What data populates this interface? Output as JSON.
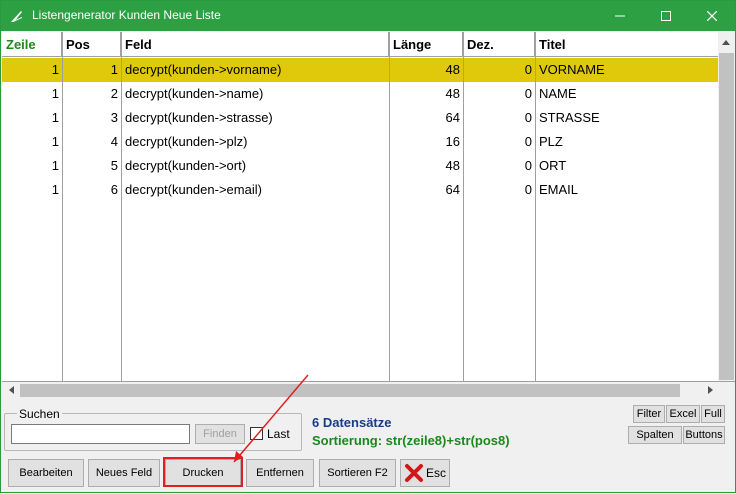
{
  "window": {
    "title": "Listengenerator Kunden Neue Liste"
  },
  "grid": {
    "columns": [
      "Zeile",
      "Pos",
      "Feld",
      "Länge",
      "Dez.",
      "Titel"
    ],
    "rows": [
      {
        "zeile": "1",
        "pos": "1",
        "feld": "decrypt(kunden->vorname)",
        "laenge": "48",
        "dez": "0",
        "titel": "VORNAME",
        "selected": true
      },
      {
        "zeile": "1",
        "pos": "2",
        "feld": "decrypt(kunden->name)",
        "laenge": "48",
        "dez": "0",
        "titel": "NAME"
      },
      {
        "zeile": "1",
        "pos": "3",
        "feld": "decrypt(kunden->strasse)",
        "laenge": "64",
        "dez": "0",
        "titel": "STRASSE"
      },
      {
        "zeile": "1",
        "pos": "4",
        "feld": "decrypt(kunden->plz)",
        "laenge": "16",
        "dez": "0",
        "titel": "PLZ"
      },
      {
        "zeile": "1",
        "pos": "5",
        "feld": "decrypt(kunden->ort)",
        "laenge": "48",
        "dez": "0",
        "titel": "ORT"
      },
      {
        "zeile": "1",
        "pos": "6",
        "feld": "decrypt(kunden->email)",
        "laenge": "64",
        "dez": "0",
        "titel": "EMAIL"
      }
    ],
    "selected_color": "#e0c90a"
  },
  "search": {
    "group_label": "Suchen",
    "value": "",
    "find_label": "Finden",
    "last_label": "Last"
  },
  "status": {
    "count": "6 Datensätze",
    "sort": "Sortierung: str(zeile8)+str(pos8)"
  },
  "tools": {
    "filter": "Filter",
    "excel": "Excel",
    "full": "Full",
    "spalten": "Spalten",
    "buttons": "Buttons"
  },
  "actions": {
    "bearbeiten": "Bearbeiten",
    "neues_feld": "Neues Feld",
    "drucken": "Drucken",
    "entfernen": "Entfernen",
    "sortieren": "Sortieren F2",
    "esc": "Esc"
  },
  "colors": {
    "titlebar": "#2ea044",
    "header_first": "#1a8a1a",
    "status_count": "#1a3a8a",
    "status_sort": "#1a8a1a",
    "highlight": "#e02020"
  }
}
